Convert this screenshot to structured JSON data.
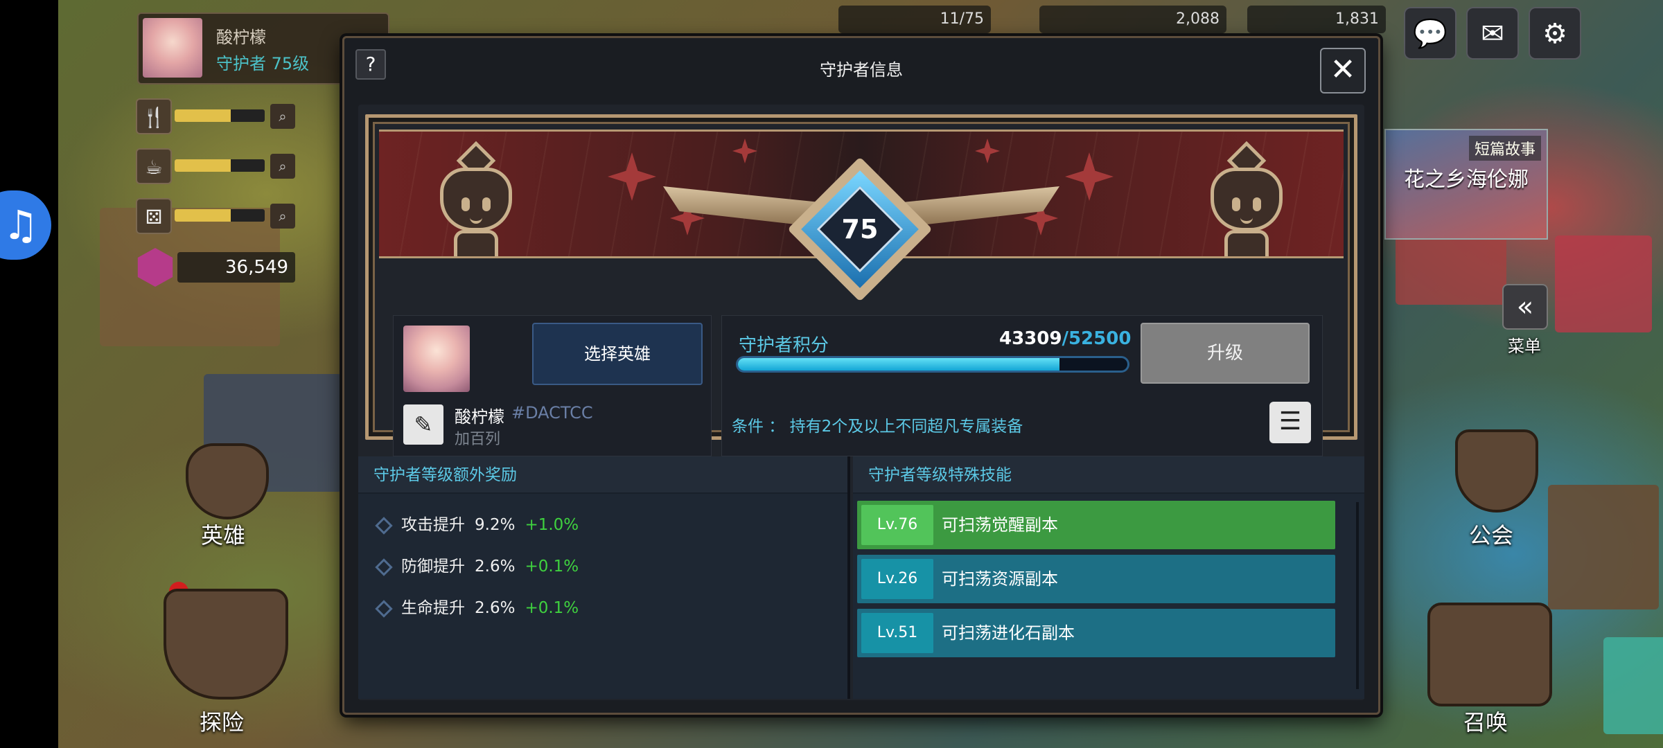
{
  "top_left": {
    "player_name": "酸柠檬",
    "player_rank": "守护者 75级",
    "gem_count": "36,549"
  },
  "top_resources": [
    "11/75",
    "2,088",
    "1,831"
  ],
  "top_icons": [
    "chat-icon",
    "mail-icon",
    "gear-icon"
  ],
  "side_nav": {
    "heroes": "英雄",
    "adventure": "探险",
    "guild": "公会",
    "summon": "召唤",
    "menu": "菜单"
  },
  "story_banner": {
    "tag": "短篇故事",
    "title": "花之乡海伦娜"
  },
  "dialog": {
    "help": "?",
    "title": "守护者信息",
    "close": "✕",
    "level": "75",
    "choose_hero": "选择英雄",
    "hero_name": "酸柠檬",
    "hero_id": "#DACTCC",
    "hero_guild": "加百列",
    "score_label": "守护者积分",
    "score_current": "43309",
    "score_max": "/52500",
    "score_fraction": 0.825,
    "upgrade": "升级",
    "condition": "条件 ： 持有2个及以上不同超凡专属装备"
  },
  "bonus_section": {
    "title": "守护者等级额外奖励",
    "items": [
      {
        "label": "攻击提升",
        "value": "9.2%",
        "plus": "+1.0%"
      },
      {
        "label": "防御提升",
        "value": "2.6%",
        "plus": "+0.1%"
      },
      {
        "label": "生命提升",
        "value": "2.6%",
        "plus": "+0.1%"
      }
    ]
  },
  "skill_section": {
    "title": "守护者等级特殊技能",
    "items": [
      {
        "level": "Lv.76",
        "name": "可扫荡觉醒副本",
        "state": "active"
      },
      {
        "level": "Lv.26",
        "name": "可扫荡资源副本",
        "state": "normal"
      },
      {
        "level": "Lv.51",
        "name": "可扫荡进化石副本",
        "state": "normal"
      }
    ]
  },
  "colors": {
    "accent_cyan": "#5cc9e6",
    "plus_green": "#3fd13f",
    "skill_active": "#3c9a41",
    "skill_normal": "#1d6f85"
  }
}
